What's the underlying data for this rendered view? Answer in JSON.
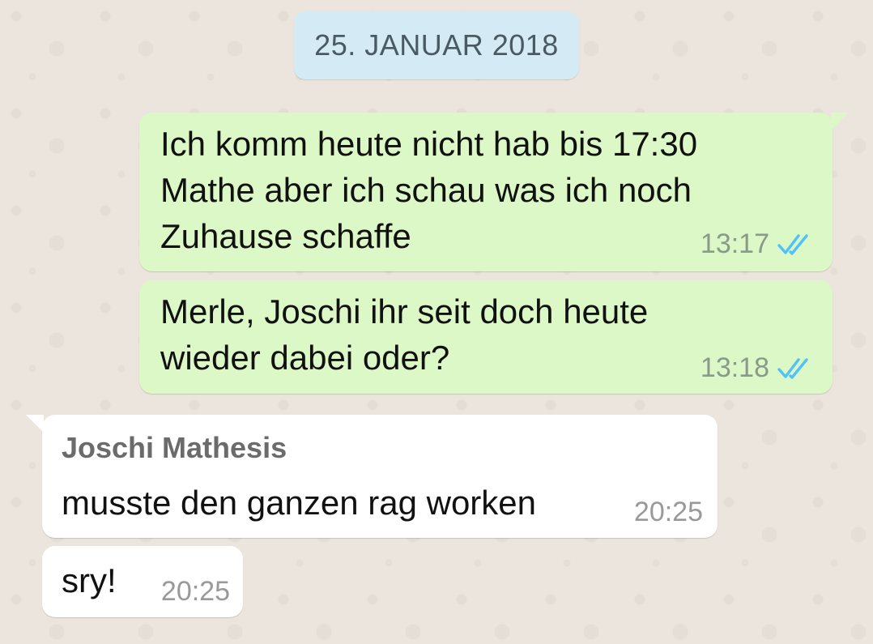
{
  "date_separator": "25. JANUAR 2018",
  "messages": [
    {
      "direction": "outgoing",
      "text": "Ich komm heute nicht hab bis 17:30\nMathe aber ich schau was ich noch\nZuhause schaffe",
      "time": "13:17",
      "status_icon": "double-check-read-icon"
    },
    {
      "direction": "outgoing",
      "text": "Merle, Joschi ihr seit doch heute\nwieder dabei oder?",
      "time": "13:18",
      "status_icon": "double-check-read-icon"
    },
    {
      "direction": "incoming",
      "sender": "Joschi Mathesis",
      "text": "musste den ganzen rag worken",
      "time": "20:25"
    },
    {
      "direction": "incoming",
      "text": "sry!",
      "time": "20:25"
    }
  ],
  "colors": {
    "background": "#ece5dd",
    "outgoing_bubble": "#dcf8c6",
    "incoming_bubble": "#ffffff",
    "date_chip": "#d4eaf4",
    "read_ticks": "#4fc3f7"
  }
}
